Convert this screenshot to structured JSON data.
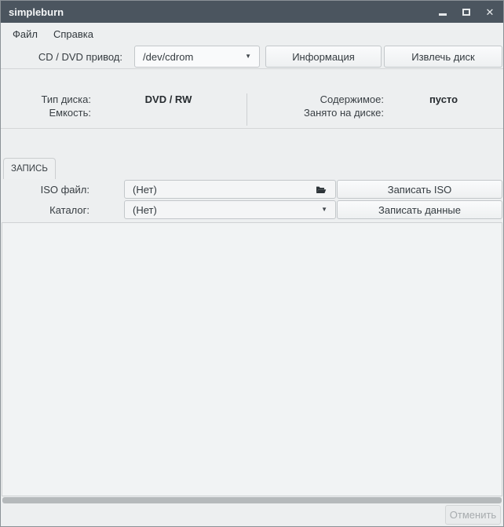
{
  "window": {
    "title": "simpleburn"
  },
  "icons": {
    "close_glyph": "✕",
    "dropdown_glyph": "▼",
    "minimize": "minimize-bar",
    "maximize": "maximize-square",
    "open_file": "open-folder"
  },
  "menu": {
    "items": [
      {
        "label": "Файл"
      },
      {
        "label": "Справка"
      }
    ]
  },
  "drive": {
    "label": "CD / DVD привод:",
    "device": {
      "value": "/dev/cdrom"
    },
    "info_button": "Информация",
    "eject_button": "Извлечь диск"
  },
  "disc_info": {
    "left": [
      {
        "label": "Тип диска:",
        "value": "DVD / RW"
      },
      {
        "label": "Емкость:",
        "value": ""
      }
    ],
    "right": [
      {
        "label": "Содержимое:",
        "value": "пусто"
      },
      {
        "label": "Занято на диске:",
        "value": ""
      }
    ]
  },
  "tabs": [
    {
      "label": "ЗАПИСЬ",
      "active": true
    }
  ],
  "burn": {
    "iso": {
      "label": "ISO файл:",
      "value": "(Нет)",
      "button": "Записать ISO"
    },
    "data": {
      "label": "Каталог:",
      "value": "(Нет)",
      "button": "Записать данные"
    }
  },
  "footer": {
    "cancel_button": "Отменить",
    "cancel_enabled": false
  },
  "colors": {
    "titlebar": "#4b555f",
    "window_bg": "#edeff0",
    "control_border": "#c3c7ca",
    "progress_trough": "#b5b9bb",
    "content_bg": "#f1f3f4"
  }
}
